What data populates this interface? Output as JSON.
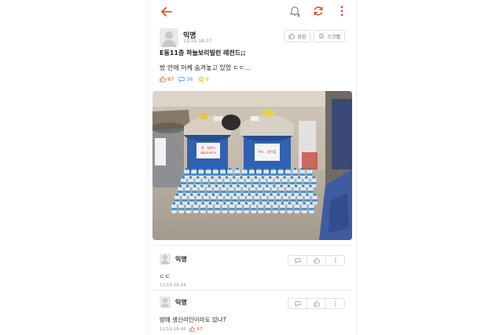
{
  "header": {
    "back_icon": "back-arrow-icon",
    "accent": "#d9532c"
  },
  "post": {
    "author": "익명",
    "time": "12/19 18:37",
    "like_btn": "공감",
    "scrap_btn": "스크랩",
    "title": "E동11층 하늘보리빌런 레전드;;",
    "body": "방 안에 어케 숨겨놓고 있었   ㄷㄷ...",
    "likes": "87",
    "comments": "36",
    "scraps": "8",
    "photo": {
      "bin_left": "캔 . 일반쓰 (페트SUPETI)",
      "bin_right": "박스 . 종이류"
    }
  },
  "comments": [
    {
      "author": "익명",
      "text": "ㄷㄷ",
      "time": "12/19 18:44",
      "likes": ""
    },
    {
      "author": "익명",
      "text": "방에 생산라인이라도 있나?",
      "time": "12/19 18:48",
      "likes": "67"
    }
  ]
}
